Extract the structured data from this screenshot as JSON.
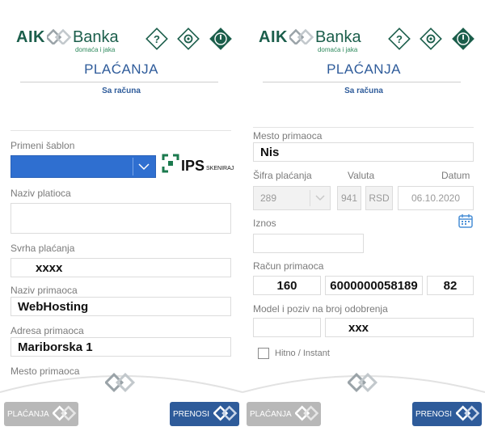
{
  "brand": {
    "aik": "AIK",
    "banka": "Banka",
    "tagline": "domaća i jaka",
    "green": "#1b5e4b",
    "blue": "#2e5b9a"
  },
  "header_icons": [
    "help-icon",
    "gear-icon",
    "power-icon"
  ],
  "left": {
    "title": "PLAĆANJA",
    "subtitle": "Sa računa",
    "template": {
      "label": "Primeni šablon",
      "value": ""
    },
    "ips": {
      "big": "IPS",
      "small": "SKENIRAJ"
    },
    "payer_name": {
      "label": "Naziv platioca",
      "value": ""
    },
    "purpose": {
      "label": "Svrha plaćanja",
      "value": "xxxx"
    },
    "recipient_name": {
      "label": "Naziv primaoca",
      "value": "WebHosting"
    },
    "recipient_address": {
      "label": "Adresa primaoca",
      "value": "Mariborska 1"
    },
    "recipient_place": {
      "label": "Mesto primaoca"
    }
  },
  "right": {
    "title": "PLAĆANJA",
    "subtitle": "Sa računa",
    "recipient_place": {
      "label": "Mesto primaoca",
      "value": "Nis"
    },
    "payment_code": {
      "label": "Šifra plaćanja",
      "value": "289"
    },
    "currency": {
      "label": "Valuta",
      "code": "941",
      "name": "RSD"
    },
    "date": {
      "label": "Datum",
      "value": "06.10.2020"
    },
    "amount": {
      "label": "Iznos",
      "value": ""
    },
    "account": {
      "label": "Račun primaoca",
      "bank": "160",
      "number": "6000000058189",
      "control": "82"
    },
    "reference": {
      "label": "Model i poziv na broj odobrenja",
      "model": "",
      "number": "xxx"
    },
    "instant": {
      "label": "Hitno / Instant",
      "checked": false
    }
  },
  "nav": {
    "payments_label": "PLAĆANJA",
    "transfers_label": "PRENOSI"
  }
}
